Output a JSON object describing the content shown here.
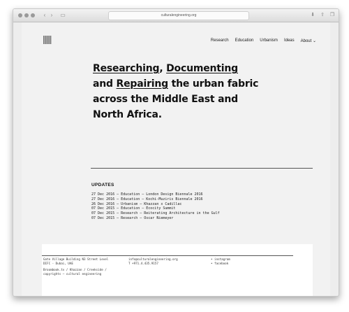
{
  "browser": {
    "url": "culturalengineering.org"
  },
  "nav": {
    "items": [
      "Research",
      "Education",
      "Urbanism",
      "Ideas",
      "About ⌄"
    ]
  },
  "hero": {
    "w1": "Researching",
    "w2": ",",
    "w3": "Documenting",
    "w4": "and",
    "w5": "Repairing",
    "w6": "the urban fabric across the Middle East and North Africa."
  },
  "updates": {
    "title": "UPDATES",
    "items": [
      "27 Dec 2016 — Education — London Design Biennale 2016",
      "27 Dec 2016 — Education — Kochi-Muziris Biennale 2016",
      "26 Dec 2016 — Urbanism — Khazzan x Cadillac",
      "07 Dec 2015 — Education — Ecocity Summit",
      "07 Dec 2015 — Research — Reiterating Architecture in the Gulf",
      "07 Dec 2015 — Research — Oscar Niemeyer"
    ]
  },
  "footer": {
    "address1": "Gate Village Building N3 Street Level",
    "address2": "DIFC - Dubai, UAE",
    "email": "info@culturalengineering.org",
    "phone": "T +971.4.435.9157",
    "social1": "• instagram",
    "social2": "• facebook",
    "links": "Broombook.tv / Khazzan / Creekside /",
    "copyright": "copyrights — cultural engineering"
  }
}
